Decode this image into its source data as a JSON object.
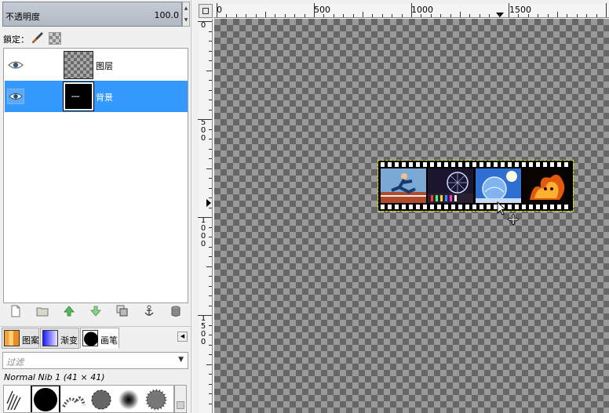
{
  "layers_panel": {
    "opacity_label": "不透明度",
    "opacity_value": "100.0",
    "lock_label": "鎖定：",
    "layers": [
      {
        "name": "图层",
        "visible": true,
        "selected": false
      },
      {
        "name": "背景",
        "visible": true,
        "selected": true
      }
    ]
  },
  "resource_tabs": [
    {
      "label": "图案"
    },
    {
      "label": "渐变"
    },
    {
      "label": "画笔",
      "active": true
    }
  ],
  "brushes": {
    "filter_placeholder": "过滤",
    "selected_brush": "Normal Nib 1 (41 × 41)"
  },
  "ruler": {
    "horizontal_labels": [
      "0",
      "500",
      "1000",
      "1500"
    ],
    "vertical_labels": [
      "0",
      "500",
      "1000",
      "1500"
    ]
  },
  "colors": {
    "selection_blue": "#3399ff",
    "marching_ants": "#e6e600"
  }
}
